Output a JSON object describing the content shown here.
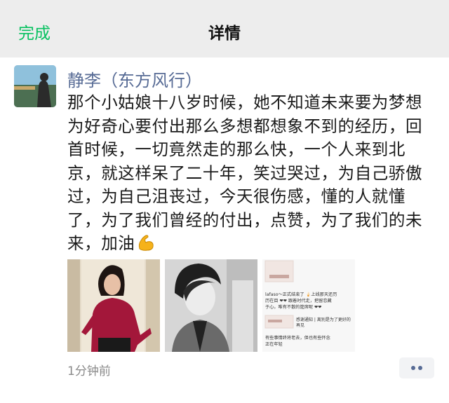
{
  "nav": {
    "done_label": "完成",
    "title": "详情"
  },
  "post": {
    "author": "静李（东方风行）",
    "text": "那个小姑娘十八岁时候，她不知道未来要为梦想为好奇心要付出那么多想都想象不到的经历，回首时候，一切竟然走的那么快，一个人来到北京，就这样呆了二十年，笑过哭过，为自己骄傲过，为自己沮丧过，今天很伤感，懂的人就懂了，为了我们曾经的付出，点赞，为了我们的未来，加油",
    "emoji": "flexed-biceps-icon",
    "time": "1分钟前",
    "photo3_lines": [
      "lafaso～正式结束了 🍦上线那天还历",
      "历在目 ❤❤ 跟着时代走，把留恋藏",
      "于心。唯有不散的筵席呢 ❤❤",
      "感谢通知 | 离别是为了更好的",
      "再见",
      "有些事情终将老去，但也有些怀念",
      "正在年轻"
    ]
  },
  "colors": {
    "accent_green": "#07c160",
    "link_blue": "#576b95",
    "nav_bg": "#ededed"
  }
}
